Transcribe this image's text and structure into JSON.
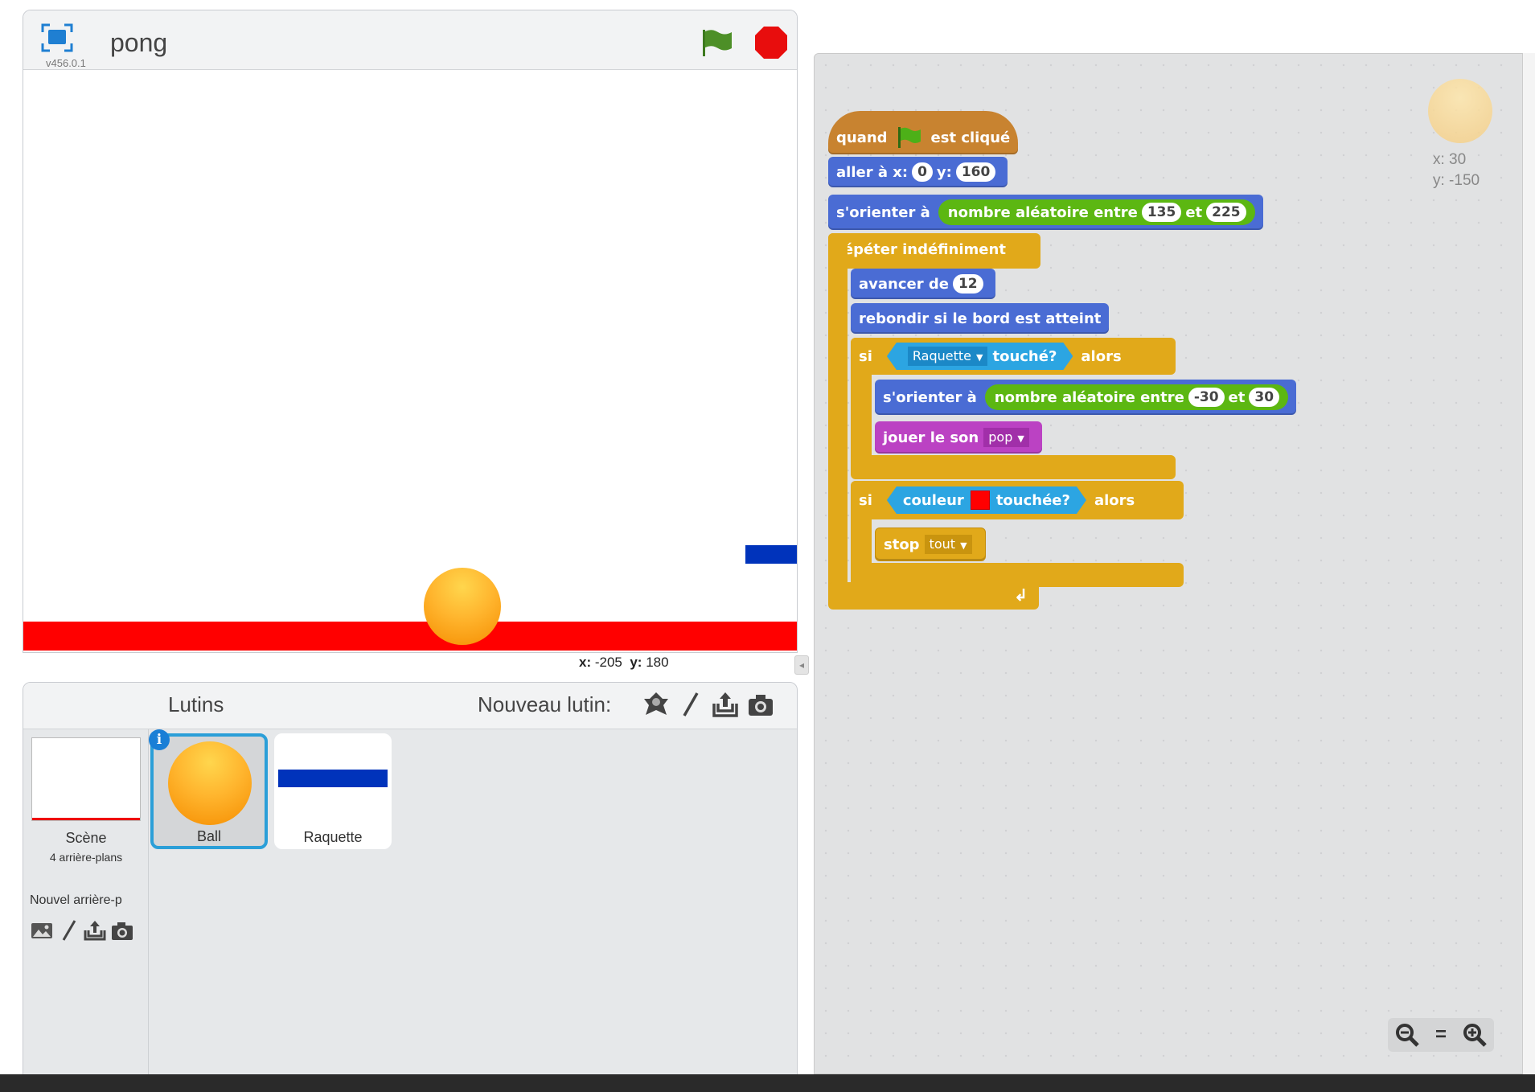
{
  "stage": {
    "title": "pong",
    "version": "v456.0.1",
    "coords": {
      "x_label": "x:",
      "x_value": "-205",
      "y_label": "y:",
      "y_value": "180"
    }
  },
  "sprites_pane": {
    "title": "Lutins",
    "new_sprite_label": "Nouveau lutin:",
    "stage_label": "Scène",
    "stage_backdrops": "4 arrière-plans",
    "new_backdrop_label": "Nouvel arrière-p",
    "sprites": [
      {
        "name": "Ball",
        "selected": true
      },
      {
        "name": "Raquette",
        "selected": false
      }
    ],
    "info_badge": "i"
  },
  "script": {
    "hat": {
      "pre": "quand",
      "post": "est cliqué"
    },
    "goto": {
      "label": "aller à x:",
      "x": "0",
      "y_label": "y:",
      "y": "160"
    },
    "point1": {
      "label": "s'orienter à",
      "op_label": "nombre aléatoire entre",
      "a": "135",
      "and": "et",
      "b": "225"
    },
    "forever": {
      "label": "répéter indéfiniment"
    },
    "move": {
      "label": "avancer de",
      "value": "12"
    },
    "bounce": {
      "label": "rebondir si le bord est atteint"
    },
    "if1": {
      "si": "si",
      "sprite": "Raquette",
      "touched": "touché?",
      "then": "alors"
    },
    "point2": {
      "label": "s'orienter à",
      "op_label": "nombre aléatoire entre",
      "a": "-30",
      "and": "et",
      "b": "30"
    },
    "sound": {
      "label": "jouer le son",
      "value": "pop"
    },
    "if2": {
      "si": "si",
      "color_label": "couleur",
      "touched": "touchée?",
      "then": "alors"
    },
    "stop": {
      "label": "stop",
      "value": "tout"
    }
  },
  "script_area": {
    "sprite_x": "x: 30",
    "sprite_y": "y: -150",
    "zoom_out": "−",
    "zoom_reset": "=",
    "zoom_in": "+"
  },
  "colors": {
    "floor": "#ff0000",
    "paddle": "#0033bb",
    "touch_color": "#ff0000",
    "selection": "#2b9fd8"
  }
}
